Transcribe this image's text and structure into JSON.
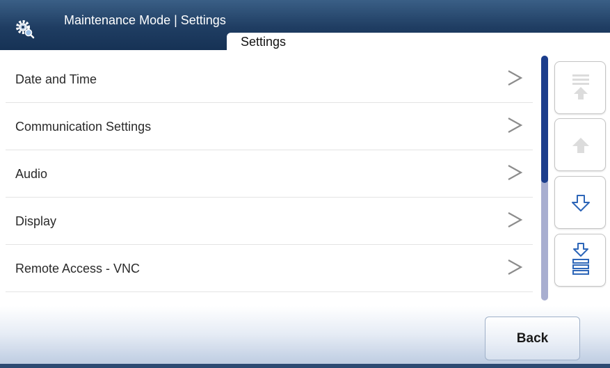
{
  "header": {
    "title": "Maintenance Mode | Settings",
    "icon": "gear-magnifier-icon",
    "tab_label": "Settings"
  },
  "menu": {
    "items": [
      {
        "label": "Date and Time"
      },
      {
        "label": "Communication Settings"
      },
      {
        "label": "Audio"
      },
      {
        "label": "Display"
      },
      {
        "label": "Remote Access - VNC"
      }
    ]
  },
  "scroll": {
    "thumb_fraction": 0.52,
    "buttons": [
      "scroll-to-top-icon",
      "scroll-up-icon",
      "scroll-down-icon",
      "scroll-to-bottom-icon"
    ]
  },
  "footer": {
    "back_label": "Back"
  },
  "colors": {
    "header_bg": "#1f3d62",
    "scroll_thumb": "#1b3d8c",
    "scroll_track": "#a8aed0",
    "arrow_enabled": "#2d66b8",
    "arrow_disabled": "#dcdcdc"
  }
}
